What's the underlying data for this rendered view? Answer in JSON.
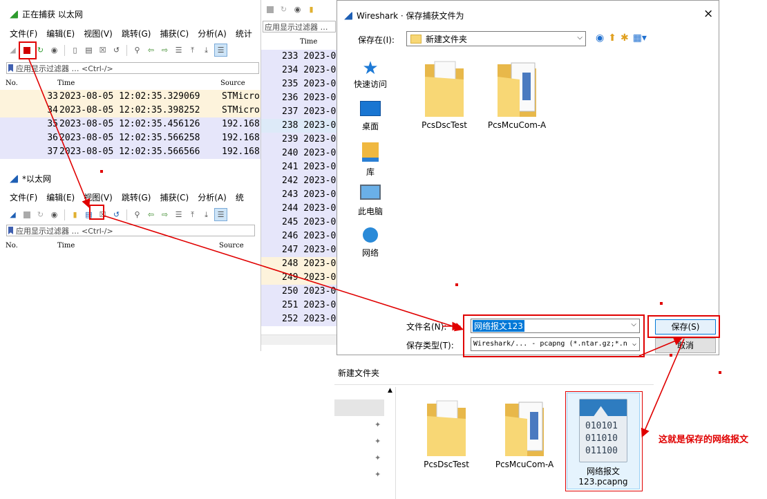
{
  "win1": {
    "title": "正在捕获 以太网",
    "menu": [
      "文件(F)",
      "编辑(E)",
      "视图(V)",
      "跳转(G)",
      "捕获(C)",
      "分析(A)",
      "统计"
    ],
    "filter_placeholder": "应用显示过滤器 … <Ctrl-/>",
    "columns": [
      "No.",
      "Time",
      "Source"
    ],
    "rows": [
      {
        "no": "33",
        "time": "2023-08-05 12:02:35.329069",
        "src": "STMicro"
      },
      {
        "no": "34",
        "time": "2023-08-05 12:02:35.398252",
        "src": "STMicro"
      },
      {
        "no": "35",
        "time": "2023-08-05 12:02:35.456126",
        "src": "192.168"
      },
      {
        "no": "36",
        "time": "2023-08-05 12:02:35.566258",
        "src": "192.168"
      },
      {
        "no": "37",
        "time": "2023-08-05 12:02:35.566566",
        "src": "192.168"
      }
    ]
  },
  "win2": {
    "title": "*以太网",
    "menu": [
      "文件(F)",
      "编辑(E)",
      "视图(V)",
      "跳转(G)",
      "捕获(C)",
      "分析(A)",
      "统"
    ],
    "filter_placeholder": "应用显示过滤器 … <Ctrl-/>",
    "columns": [
      "No.",
      "Time",
      "Source"
    ]
  },
  "bgwin": {
    "filter_placeholder": "应用显示过滤器 …",
    "time_header": "Time",
    "rows": [
      "233 2023-0",
      "234 2023-0",
      "235 2023-0",
      "236 2023-0",
      "237 2023-0",
      "238 2023-0",
      "239 2023-0",
      "240 2023-0",
      "241 2023-0",
      "242 2023-0",
      "243 2023-0",
      "244 2023-0",
      "245 2023-0",
      "246 2023-0",
      "247 2023-0",
      "248 2023-0",
      "249 2023-0",
      "250 2023-0",
      "251 2023-0",
      "252 2023-0"
    ]
  },
  "dialog": {
    "title": "Wireshark · 保存捕获文件为",
    "save_in_label": "保存在(I):",
    "save_in_value": "新建文件夹",
    "places": [
      "快速访问",
      "桌面",
      "库",
      "此电脑",
      "网络"
    ],
    "files": [
      "PcsDscTest",
      "PcsMcuCom-A"
    ],
    "filename_label": "文件名(N):",
    "filename_value": "网络报文123",
    "filetype_label": "保存类型(T):",
    "filetype_value": "Wireshark/... - pcapng (*.ntar.gz;*.n",
    "save_button": "保存(S)",
    "cancel_button": "取消",
    "close": "×"
  },
  "explorer": {
    "folder_title": "新建文件夹",
    "files": [
      "PcsDscTest",
      "PcsMcuCom-A"
    ],
    "saved_file_line1": "网络报文",
    "saved_file_line2": "123.pcapng",
    "binary_lines": [
      "010101",
      "011010",
      "011100"
    ]
  },
  "annotation": "这就是保存的网络报文",
  "colors": {
    "annotation_red": "#e00000",
    "row_tan": "#fdf3dc",
    "row_lavender": "#e6e6fa",
    "folder_yellow": "#f8d775"
  }
}
